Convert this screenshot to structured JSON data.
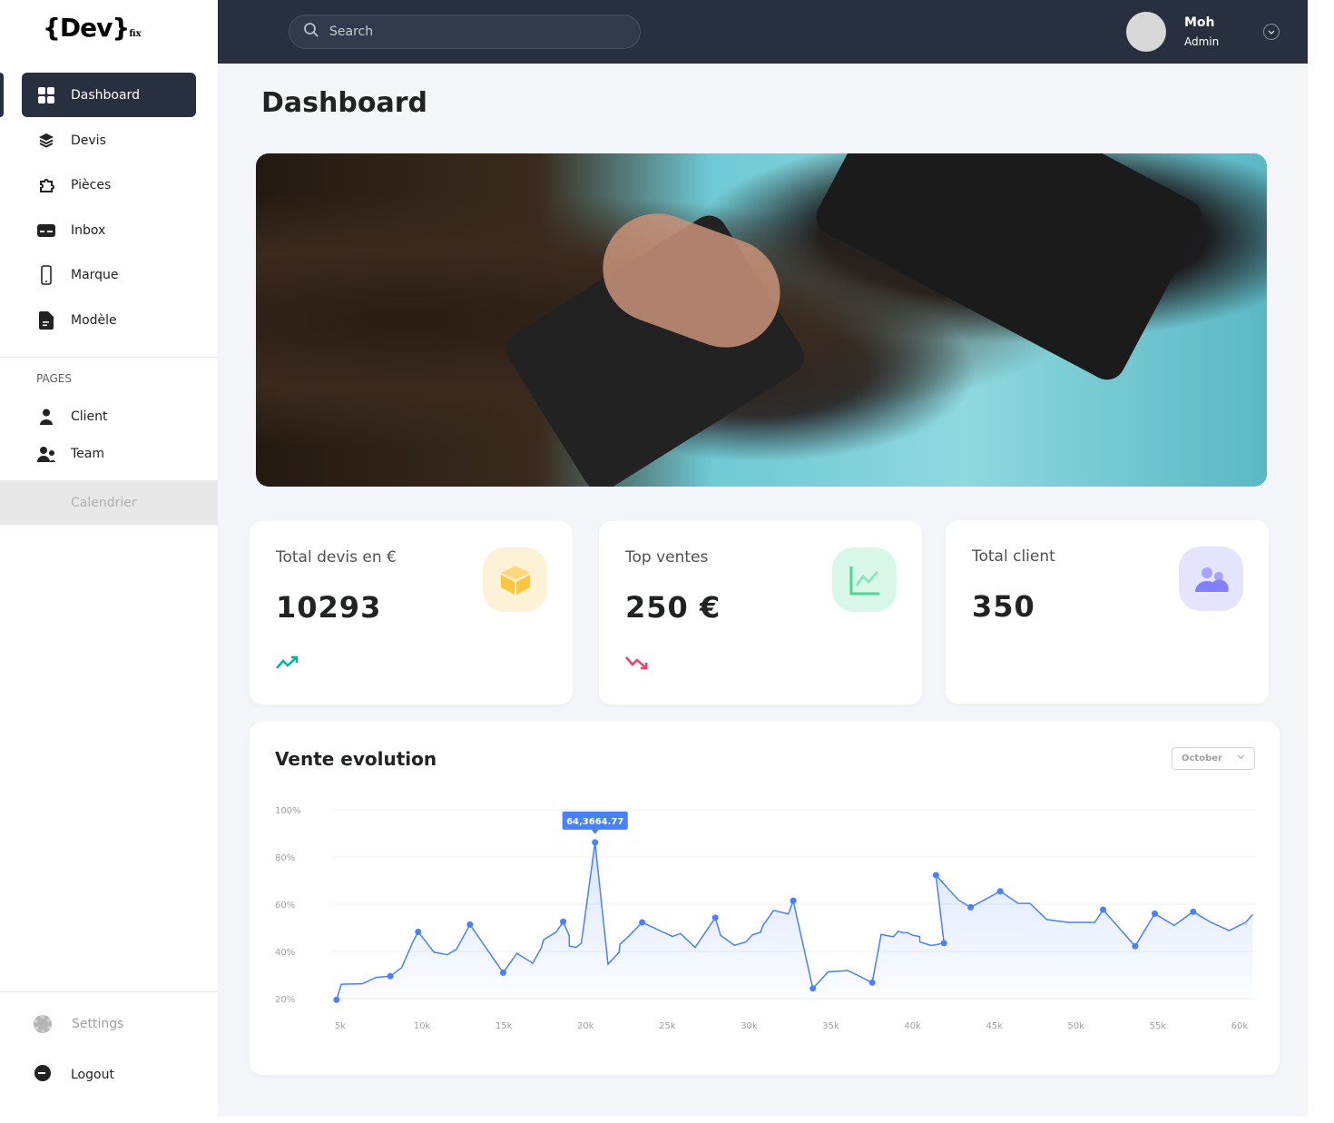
{
  "logo": {
    "text": "{Dev}",
    "sub": "fix"
  },
  "sidebar": {
    "items": [
      {
        "label": "Dashboard",
        "icon": "grid-icon"
      },
      {
        "label": "Devis",
        "icon": "layers-icon"
      },
      {
        "label": "Pièces",
        "icon": "puzzle-icon"
      },
      {
        "label": "Inbox",
        "icon": "card-icon"
      },
      {
        "label": "Marque",
        "icon": "phone-icon"
      },
      {
        "label": "Modèle",
        "icon": "document-icon"
      }
    ],
    "section_label": "PAGES",
    "pages": [
      {
        "label": "Client",
        "icon": "user-icon"
      },
      {
        "label": "Team",
        "icon": "team-icon"
      },
      {
        "label": "Calendrier"
      }
    ],
    "settings": "Settings",
    "logout": "Logout"
  },
  "header": {
    "search_placeholder": "Search",
    "user_name": "Moh",
    "user_role": "Admin"
  },
  "main": {
    "title": "Dashboard",
    "cards": [
      {
        "label": "Total devis en €",
        "value": "10293",
        "trend": "up",
        "color": "#fec53d"
      },
      {
        "label": "Top ventes",
        "value": "250 €",
        "trend": "down",
        "color": "#4ad991"
      },
      {
        "label": "Total client",
        "value": "350",
        "color": "#8280ff"
      }
    ],
    "chart_title": "Vente evolution",
    "dropdown": "October"
  },
  "chart_data": {
    "type": "area",
    "title": "Vente evolution",
    "xlabel": "",
    "ylabel": "",
    "x_ticks": [
      "5k",
      "10k",
      "15k",
      "20k",
      "25k",
      "30k",
      "35k",
      "40k",
      "45k",
      "50k",
      "55k",
      "60k"
    ],
    "x_tick_values": [
      5,
      10,
      15,
      20,
      25,
      30,
      35,
      40,
      45,
      50,
      55,
      60
    ],
    "y_ticks": [
      "100%",
      "80%",
      "60%",
      "40%",
      "20%"
    ],
    "y_tick_values": [
      100,
      80,
      60,
      40,
      20
    ],
    "xlim": [
      5,
      60
    ],
    "ylim": [
      20,
      100
    ],
    "grid": true,
    "tooltip": {
      "label": "64,3664.77",
      "x": 20.58,
      "y": 86.2
    },
    "points": [
      [
        4.77,
        19.5,
        1
      ],
      [
        5.06,
        26.1,
        0
      ],
      [
        6.35,
        26.3,
        0
      ],
      [
        7.2,
        29,
        0
      ],
      [
        8.06,
        29.5,
        1
      ],
      [
        8.76,
        33.2,
        0
      ],
      [
        9.4,
        43.5,
        0
      ],
      [
        9.76,
        48.3,
        1
      ],
      [
        10.73,
        39.7,
        0
      ],
      [
        11.54,
        38.6,
        0
      ],
      [
        12.1,
        40.9,
        0
      ],
      [
        12.93,
        51.4,
        1
      ],
      [
        14.96,
        31,
        1
      ],
      [
        15.8,
        39.2,
        0
      ],
      [
        16.77,
        35,
        0
      ],
      [
        17.29,
        41.5,
        0
      ],
      [
        17.44,
        45,
        0
      ],
      [
        18.2,
        48.1,
        0
      ],
      [
        18.63,
        52.6,
        1
      ],
      [
        19,
        46.6,
        0
      ],
      [
        19,
        42.3,
        0
      ],
      [
        19.42,
        41.7,
        0
      ],
      [
        19.74,
        43.5,
        0
      ],
      [
        20.58,
        86.2,
        1
      ],
      [
        21.37,
        34.6,
        0
      ],
      [
        22.05,
        39.6,
        0
      ],
      [
        22.1,
        43,
        0
      ],
      [
        22.6,
        46.2,
        0
      ],
      [
        23.46,
        52.3,
        1
      ],
      [
        25.32,
        46.3,
        0
      ],
      [
        25.8,
        47.6,
        0
      ],
      [
        26.7,
        41.7,
        0
      ],
      [
        27.93,
        54.3,
        1
      ],
      [
        28.26,
        46.8,
        0
      ],
      [
        29.1,
        42.6,
        0
      ],
      [
        29.8,
        44,
        0
      ],
      [
        30.2,
        47,
        0
      ],
      [
        30.7,
        48.1,
        0
      ],
      [
        30.85,
        51,
        0
      ],
      [
        31.5,
        57.4,
        0
      ],
      [
        32.4,
        55.9,
        0
      ],
      [
        32.7,
        61.5,
        1
      ],
      [
        33.9,
        24.3,
        1
      ],
      [
        34.85,
        31.4,
        0
      ],
      [
        36.05,
        31.9,
        0
      ],
      [
        37.53,
        26.8,
        1
      ],
      [
        38.08,
        47.2,
        0
      ],
      [
        38.82,
        46.2,
        0
      ],
      [
        39.14,
        48.6,
        0
      ],
      [
        39.38,
        47.9,
        0
      ],
      [
        39.69,
        48,
        0
      ],
      [
        39.93,
        47,
        0
      ],
      [
        40.43,
        46.3,
        0
      ],
      [
        40.45,
        44,
        0
      ],
      [
        41.14,
        42.5,
        0
      ],
      [
        41.92,
        43.5,
        1
      ],
      [
        41.43,
        72.3,
        1
      ],
      [
        42.79,
        61.9,
        0
      ],
      [
        43.55,
        58.7,
        1
      ],
      [
        45.36,
        65.5,
        1
      ],
      [
        46.45,
        60.4,
        0
      ],
      [
        47.19,
        60.3,
        0
      ],
      [
        48.2,
        53.5,
        0
      ],
      [
        49.53,
        52.3,
        0
      ],
      [
        51.14,
        52.3,
        0
      ],
      [
        51.65,
        57.7,
        1
      ],
      [
        53.61,
        42.2,
        1
      ],
      [
        54.81,
        56,
        1
      ],
      [
        56,
        51,
        0
      ],
      [
        57.16,
        56.8,
        1
      ],
      [
        58.2,
        52.5,
        0
      ],
      [
        59.35,
        48.8,
        0
      ],
      [
        60.37,
        52.3,
        0
      ],
      [
        60.8,
        55.7,
        0
      ]
    ],
    "line_color": "#4880ff"
  }
}
